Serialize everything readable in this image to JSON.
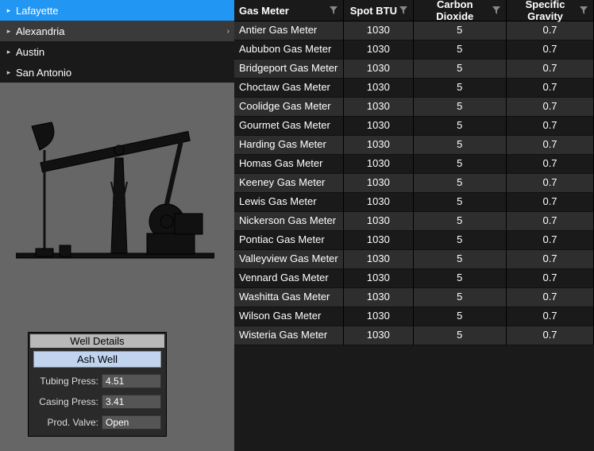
{
  "sidebar": {
    "items": [
      {
        "label": "Lafayette",
        "selected": true
      },
      {
        "label": "Alexandria",
        "hovered": true,
        "showChevron": true
      },
      {
        "label": "Austin"
      },
      {
        "label": "San Antonio"
      }
    ]
  },
  "well_details": {
    "panel_title": "Well Details",
    "well_name": "Ash Well",
    "rows": [
      {
        "label": "Tubing Press:",
        "value": "4.51"
      },
      {
        "label": "Casing Press:",
        "value": "3.41"
      },
      {
        "label": "Prod. Valve:",
        "value": "Open"
      }
    ]
  },
  "grid": {
    "columns": [
      "Gas Meter",
      "Spot BTU",
      "Carbon Dioxide",
      "Specific Gravity"
    ],
    "rows": [
      {
        "meter": "Antier Gas Meter",
        "btu": "1030",
        "co2": "5",
        "sg": "0.7"
      },
      {
        "meter": "Aububon Gas Meter",
        "btu": "1030",
        "co2": "5",
        "sg": "0.7"
      },
      {
        "meter": "Bridgeport Gas Meter",
        "btu": "1030",
        "co2": "5",
        "sg": "0.7"
      },
      {
        "meter": "Choctaw Gas Meter",
        "btu": "1030",
        "co2": "5",
        "sg": "0.7"
      },
      {
        "meter": "Coolidge Gas Meter",
        "btu": "1030",
        "co2": "5",
        "sg": "0.7"
      },
      {
        "meter": "Gourmet Gas Meter",
        "btu": "1030",
        "co2": "5",
        "sg": "0.7"
      },
      {
        "meter": "Harding Gas Meter",
        "btu": "1030",
        "co2": "5",
        "sg": "0.7"
      },
      {
        "meter": "Homas Gas Meter",
        "btu": "1030",
        "co2": "5",
        "sg": "0.7"
      },
      {
        "meter": "Keeney Gas Meter",
        "btu": "1030",
        "co2": "5",
        "sg": "0.7"
      },
      {
        "meter": "Lewis Gas Meter",
        "btu": "1030",
        "co2": "5",
        "sg": "0.7"
      },
      {
        "meter": "Nickerson Gas Meter",
        "btu": "1030",
        "co2": "5",
        "sg": "0.7"
      },
      {
        "meter": "Pontiac Gas Meter",
        "btu": "1030",
        "co2": "5",
        "sg": "0.7"
      },
      {
        "meter": "Valleyview Gas Meter",
        "btu": "1030",
        "co2": "5",
        "sg": "0.7"
      },
      {
        "meter": "Vennard Gas Meter",
        "btu": "1030",
        "co2": "5",
        "sg": "0.7"
      },
      {
        "meter": "Washitta Gas Meter",
        "btu": "1030",
        "co2": "5",
        "sg": "0.7"
      },
      {
        "meter": "Wilson Gas Meter",
        "btu": "1030",
        "co2": "5",
        "sg": "0.7"
      },
      {
        "meter": "Wisteria Gas Meter",
        "btu": "1030",
        "co2": "5",
        "sg": "0.7"
      }
    ]
  },
  "icons": {
    "caret_right": "▸",
    "chevron_right": "›"
  }
}
